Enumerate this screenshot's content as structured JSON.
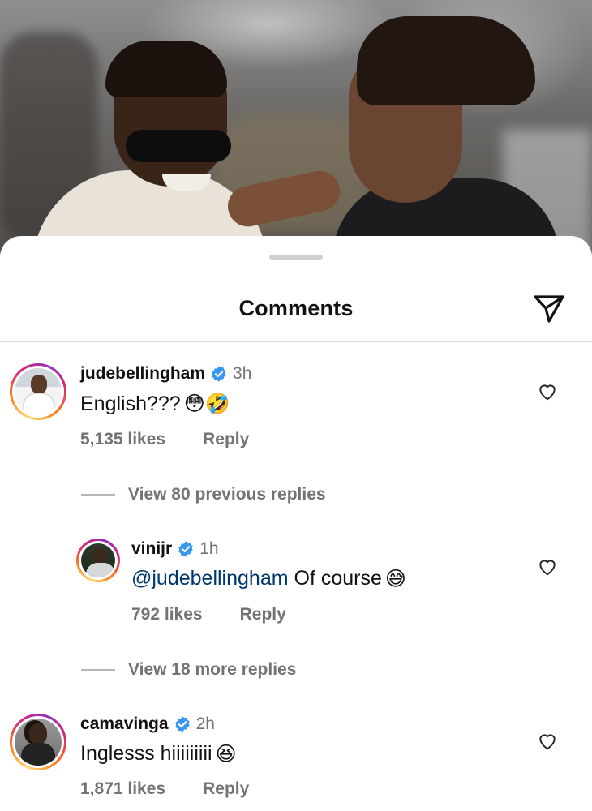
{
  "sheet": {
    "title": "Comments"
  },
  "comments": [
    {
      "username": "judebellingham",
      "time": "3h",
      "text": "English???",
      "emojis": "😳🤣",
      "likes": "5,135 likes",
      "reply_label": "Reply",
      "view_replies": "View 80 previous replies"
    },
    {
      "username": "vinijr",
      "time": "1h",
      "mention": "@judebellingham",
      "text": "Of course",
      "emojis": "😅",
      "likes": "792 likes",
      "reply_label": "Reply",
      "view_replies": "View 18 more replies"
    },
    {
      "username": "camavinga",
      "time": "2h",
      "text": "Inglesss hiiiiiiiii",
      "emojis": "😆",
      "likes": "1,871 likes",
      "reply_label": "Reply"
    }
  ],
  "icons": {
    "share": "paper-plane-icon",
    "verified": "verified-badge-icon",
    "like": "heart-icon"
  },
  "colors": {
    "verified": "#3897f0",
    "mention": "#00376b",
    "secondary_text": "#737373"
  }
}
